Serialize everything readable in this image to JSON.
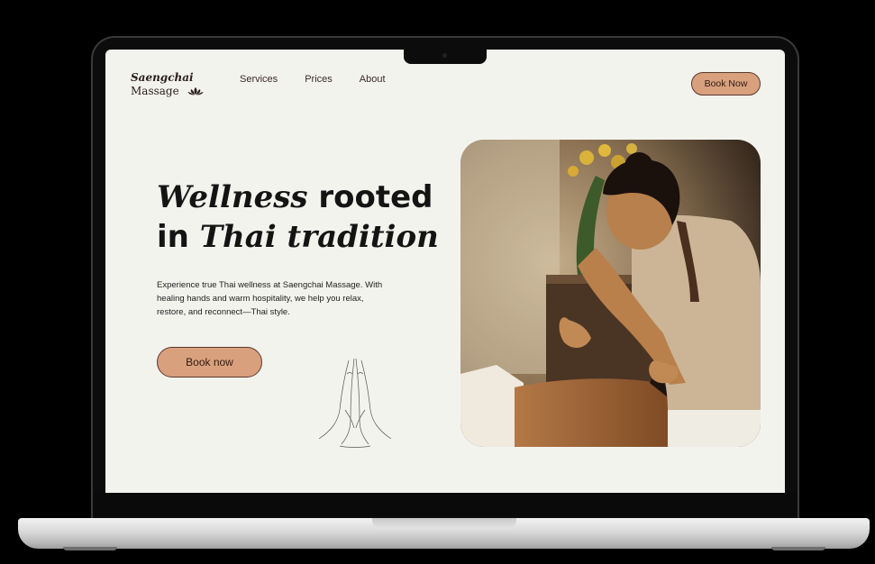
{
  "logo": {
    "line1": "Saengchai",
    "line2": "Massage"
  },
  "nav": {
    "items": [
      "Services",
      "Prices",
      "About"
    ]
  },
  "header": {
    "book_label": "Book Now"
  },
  "hero": {
    "title_em1": "Wellness",
    "title_plain1": " rooted",
    "title_plain2": "in ",
    "title_em2": "Thai tradition",
    "description": "Experience true Thai wellness at Saengchai Massage. With healing hands and warm hospitality, we help you relax, restore, and reconnect—Thai style.",
    "cta_label": "Book now"
  },
  "colors": {
    "accent": "#d9a07d",
    "accent_border": "#5a3a2c",
    "background": "#f3f3ee",
    "text": "#141414"
  },
  "icons": {
    "logo_mark": "lotus-icon",
    "decoration": "praying-hands-icon"
  }
}
